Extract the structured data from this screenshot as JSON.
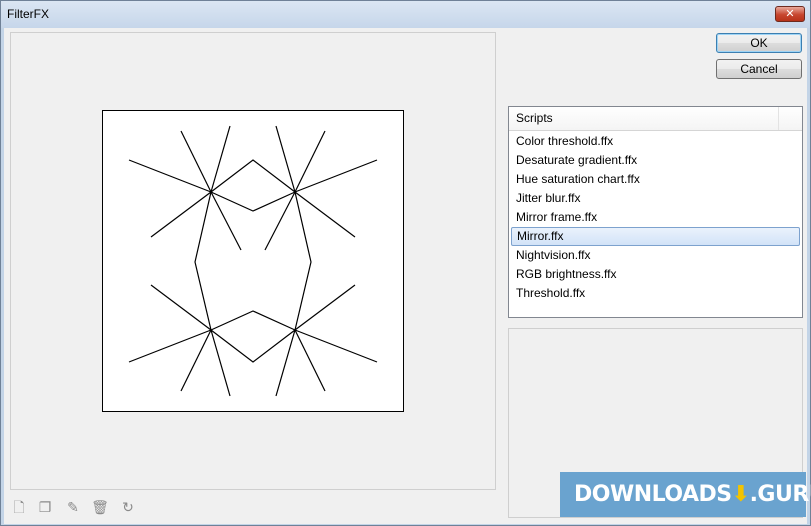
{
  "window": {
    "title": "FilterFX",
    "close_glyph": "✕"
  },
  "buttons": {
    "ok": "OK",
    "cancel": "Cancel"
  },
  "scripts": {
    "header": "Scripts",
    "items": [
      "Color threshold.ffx",
      "Desaturate gradient.ffx",
      "Hue saturation chart.ffx",
      "Jitter blur.ffx",
      "Mirror frame.ffx",
      "Mirror.ffx",
      "Nightvision.ffx",
      "RGB brightness.ffx",
      "Threshold.ffx"
    ],
    "selected_index": 5
  },
  "toolbar": [
    {
      "name": "new-script-icon",
      "glyph": "🗋"
    },
    {
      "name": "copy-script-icon",
      "glyph": "❐"
    },
    {
      "name": "edit-script-icon",
      "glyph": "✎"
    },
    {
      "name": "delete-script-icon",
      "glyph": "🗑"
    },
    {
      "name": "refresh-icon",
      "glyph": "↻"
    }
  ],
  "watermark": {
    "text_left": "DOWNLOADS",
    "text_right": ".GURU",
    "icon": "download-arrow-icon"
  },
  "colors": {
    "selection": "#d2e3f8",
    "watermark_bg": "#6aa3cf",
    "watermark_icon": "#f3c300"
  }
}
